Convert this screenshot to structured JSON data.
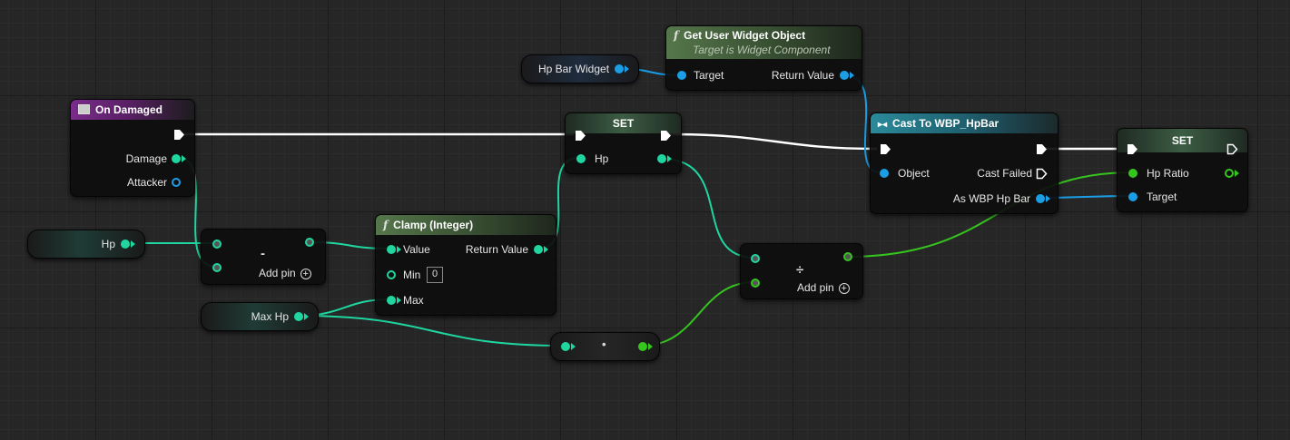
{
  "nodes": {
    "on_damaged": {
      "title": "On Damaged",
      "pins": {
        "damage": "Damage",
        "attacker": "Attacker"
      }
    },
    "get_user_widget": {
      "title": "Get User Widget Object",
      "subtitle": "Target is Widget Component",
      "pins": {
        "target": "Target",
        "return_value": "Return Value"
      }
    },
    "set_hp": {
      "title": "SET",
      "pins": {
        "hp": "Hp"
      }
    },
    "cast": {
      "title": "Cast To WBP_HpBar",
      "pins": {
        "object": "Object",
        "cast_failed": "Cast Failed",
        "as_wbp": "As WBP Hp Bar"
      }
    },
    "set_ratio": {
      "title": "SET",
      "pins": {
        "hp_ratio": "Hp Ratio",
        "target": "Target"
      }
    },
    "clamp": {
      "title": "Clamp (Integer)",
      "pins": {
        "value": "Value",
        "return_value": "Return Value",
        "min": "Min",
        "min_value": "0",
        "max": "Max"
      }
    },
    "subtract": {
      "symbol": "-",
      "add_pin": "Add pin"
    },
    "divide": {
      "symbol": "÷",
      "add_pin": "Add pin"
    },
    "convert": {
      "symbol": "•"
    }
  },
  "variables": {
    "hp_bar_widget": "Hp Bar Widget",
    "hp": "Hp",
    "max_hp": "Max Hp"
  },
  "colors": {
    "exec": "#ffffff",
    "integer": "#1fd6a0",
    "object": "#1a9ee6",
    "float": "#36c41f",
    "event_header": "#7a2c8a",
    "function_header": "#55764a",
    "cast_header": "#2b8a9a"
  }
}
